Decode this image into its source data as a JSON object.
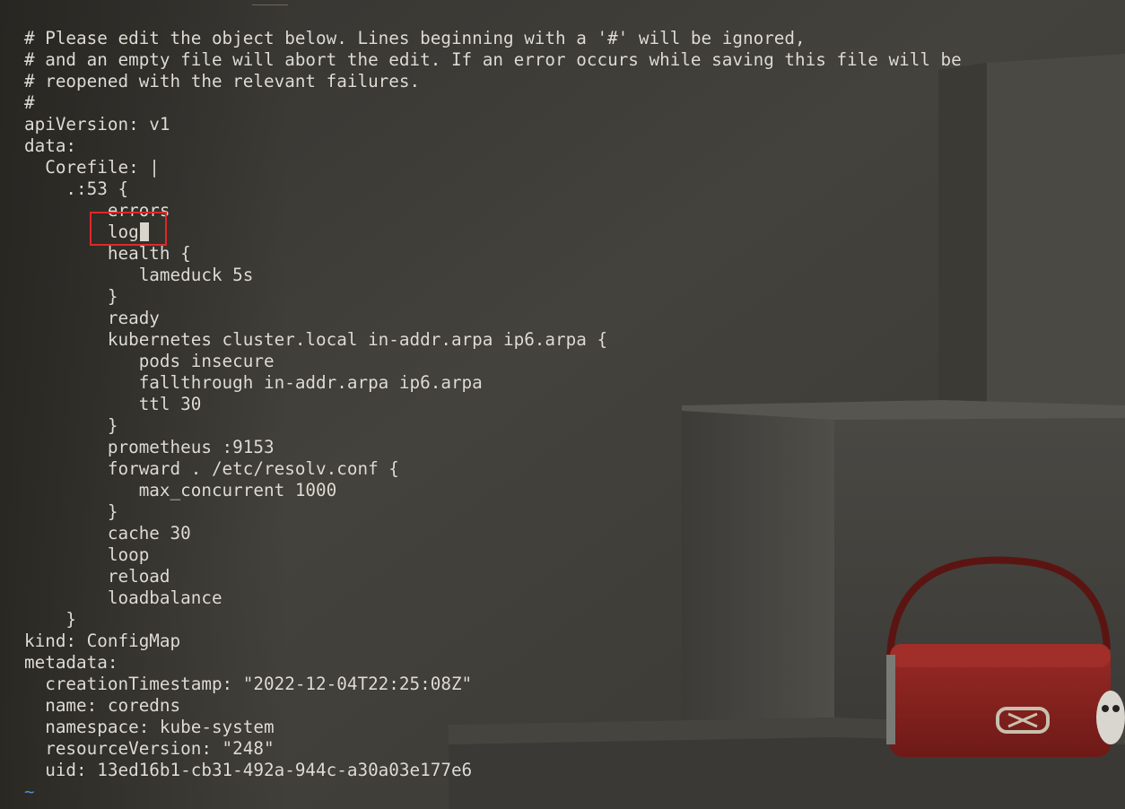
{
  "editor": {
    "lines": [
      "# Please edit the object below. Lines beginning with a '#' will be ignored,",
      "# and an empty file will abort the edit. If an error occurs while saving this file will be",
      "# reopened with the relevant failures.",
      "#",
      "apiVersion: v1",
      "data:",
      "  Corefile: |",
      "    .:53 {",
      "        errors",
      "        log",
      "        health {",
      "           lameduck 5s",
      "        }",
      "        ready",
      "        kubernetes cluster.local in-addr.arpa ip6.arpa {",
      "           pods insecure",
      "           fallthrough in-addr.arpa ip6.arpa",
      "           ttl 30",
      "        }",
      "        prometheus :9153",
      "        forward . /etc/resolv.conf {",
      "           max_concurrent 1000",
      "        }",
      "        cache 30",
      "        loop",
      "        reload",
      "        loadbalance",
      "    }",
      "kind: ConfigMap",
      "metadata:",
      "  creationTimestamp: \"2022-12-04T22:25:08Z\"",
      "  name: coredns",
      "  namespace: kube-system",
      "  resourceVersion: \"248\"",
      "  uid: 13ed16b1-cb31-492a-944c-a30a03e177e6"
    ],
    "end_marker": "~",
    "cursor_line": 9
  },
  "colors": {
    "text": "#dedcd4",
    "tilde": "#4f8fd6",
    "highlight_border": "#e02828",
    "background": "#3d3b36"
  }
}
